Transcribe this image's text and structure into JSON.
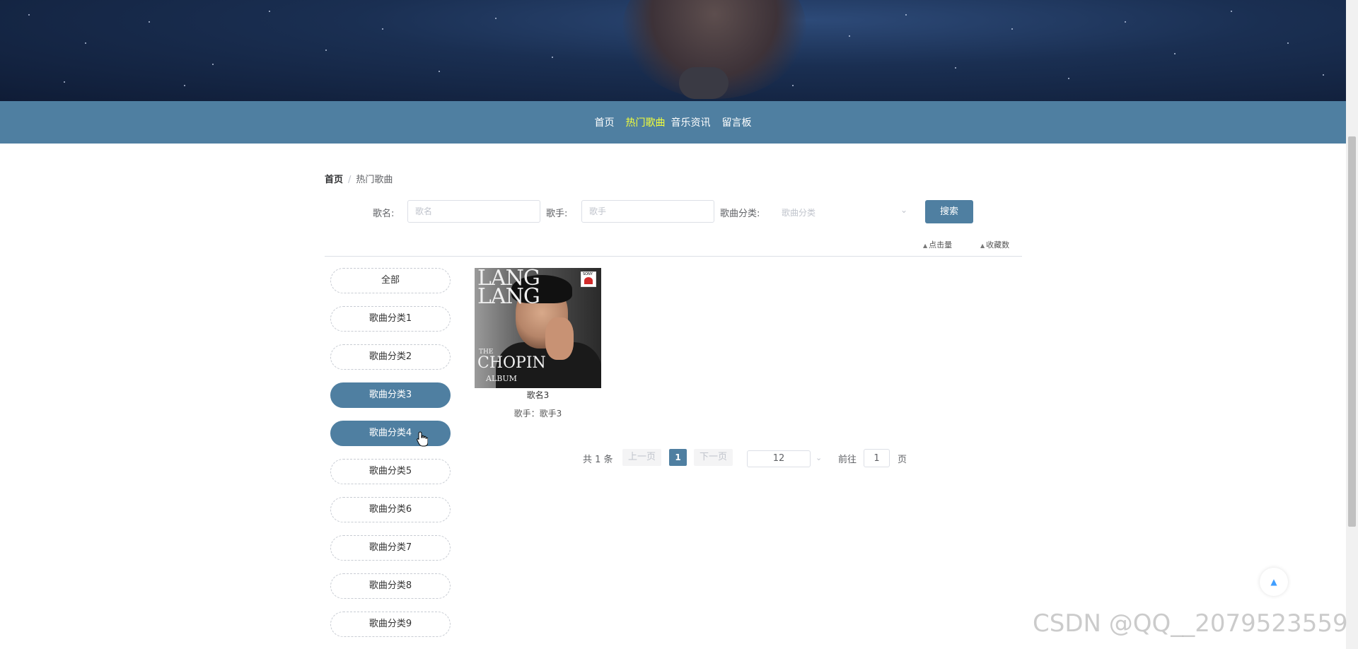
{
  "nav": {
    "items": [
      {
        "label": "首页"
      },
      {
        "label": "热门歌曲",
        "active": true
      },
      {
        "label": "音乐资讯"
      },
      {
        "label": "留言板"
      }
    ],
    "active_color": "#f3ff3a",
    "bar_color": "#4f7fa1"
  },
  "breadcrumb": {
    "home": "首页",
    "separator": "/",
    "current": "热门歌曲"
  },
  "search": {
    "song_label": "歌名:",
    "song_placeholder": "歌名",
    "singer_label": "歌手:",
    "singer_placeholder": "歌手",
    "category_label": "歌曲分类:",
    "category_placeholder": "歌曲分类",
    "button_label": "搜索"
  },
  "sort": {
    "clicks_label": "点击量",
    "favorites_label": "收藏数"
  },
  "categories": [
    {
      "label": "全部",
      "active": false
    },
    {
      "label": "歌曲分类1",
      "active": false
    },
    {
      "label": "歌曲分类2",
      "active": false
    },
    {
      "label": "歌曲分类3",
      "active": true
    },
    {
      "label": "歌曲分类4",
      "active": true
    },
    {
      "label": "歌曲分类5",
      "active": false
    },
    {
      "label": "歌曲分类6",
      "active": false
    },
    {
      "label": "歌曲分类7",
      "active": false
    },
    {
      "label": "歌曲分类8",
      "active": false
    },
    {
      "label": "歌曲分类9",
      "active": false
    }
  ],
  "songs": [
    {
      "name": "歌名3",
      "singer_text": "歌手：歌手3",
      "cover": {
        "line1": "LANG",
        "line2": "LANG",
        "line3": "THE",
        "line4": "CHOPIN",
        "line5": "ALBUM",
        "label": "SONY"
      }
    }
  ],
  "pagination": {
    "total_text": "共 1 条",
    "prev_label": "上一页",
    "current_page": "1",
    "next_label": "下一页",
    "page_size": "12",
    "goto_label": "前往",
    "goto_value": "1",
    "page_suffix": "页"
  },
  "watermark": "CSDN @QQ__2079523559"
}
